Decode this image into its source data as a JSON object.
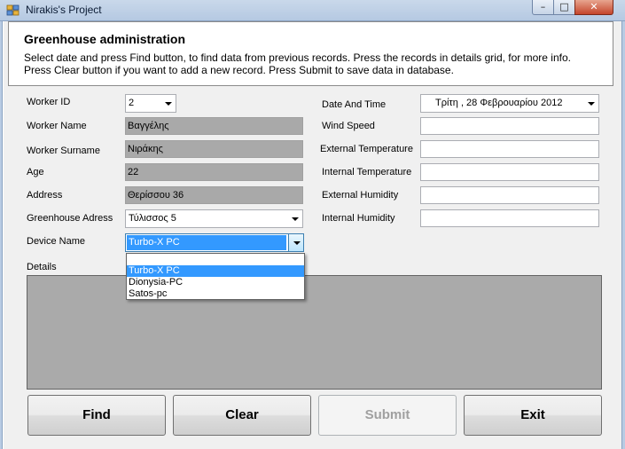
{
  "window": {
    "title": "Nirakis's Project",
    "controls": {
      "minimize": "–",
      "maximize": "□",
      "close": "✕"
    }
  },
  "header": {
    "title": "Greenhouse administration",
    "description": "Select date and press Find button, to find data from previous records. Press the records in details grid, for more info. Press Clear button if you want to add a new record. Press Submit to save data in database."
  },
  "left_form": {
    "worker_id": {
      "label": "Worker ID",
      "value": "2"
    },
    "worker_name": {
      "label": "Worker Name",
      "value": "Βαγγέλης"
    },
    "worker_surname": {
      "label": "Worker Surname",
      "value": "Νιράκης"
    },
    "age": {
      "label": "Age",
      "value": "22"
    },
    "address": {
      "label": "Address",
      "value": "Θερίσσου 36"
    },
    "greenhouse_address": {
      "label": "Greenhouse Adress",
      "value": "Τύλισσος 5"
    },
    "device_name": {
      "label": "Device Name",
      "value": "Turbo-X PC"
    }
  },
  "device_dropdown": {
    "options": [
      "",
      "Turbo-X PC",
      "Dionysia-PC",
      "Satos-pc"
    ],
    "selected_index": 1
  },
  "right_form": {
    "date_time": {
      "label": "Date And Time",
      "value": "Τρίτη    , 28 Φεβρουαρίου 2012"
    },
    "wind_speed": {
      "label": "Wind Speed",
      "value": ""
    },
    "external_temperature": {
      "label": "External Temperature",
      "value": ""
    },
    "internal_temperature": {
      "label": "Internal Temperature",
      "value": ""
    },
    "external_humidity": {
      "label": "External Humidity",
      "value": ""
    },
    "internal_humidity": {
      "label": "Internal Humidity",
      "value": ""
    }
  },
  "details": {
    "label": "Details"
  },
  "buttons": {
    "find": "Find",
    "clear": "Clear",
    "submit": "Submit",
    "exit": "Exit"
  },
  "colors": {
    "readonly_field": "#a9a9a9",
    "details_grid": "#aaaaaa",
    "selection": "#3399ff"
  },
  "icons": {
    "app": "app-icon",
    "dropdown": "chevron-down-icon"
  }
}
